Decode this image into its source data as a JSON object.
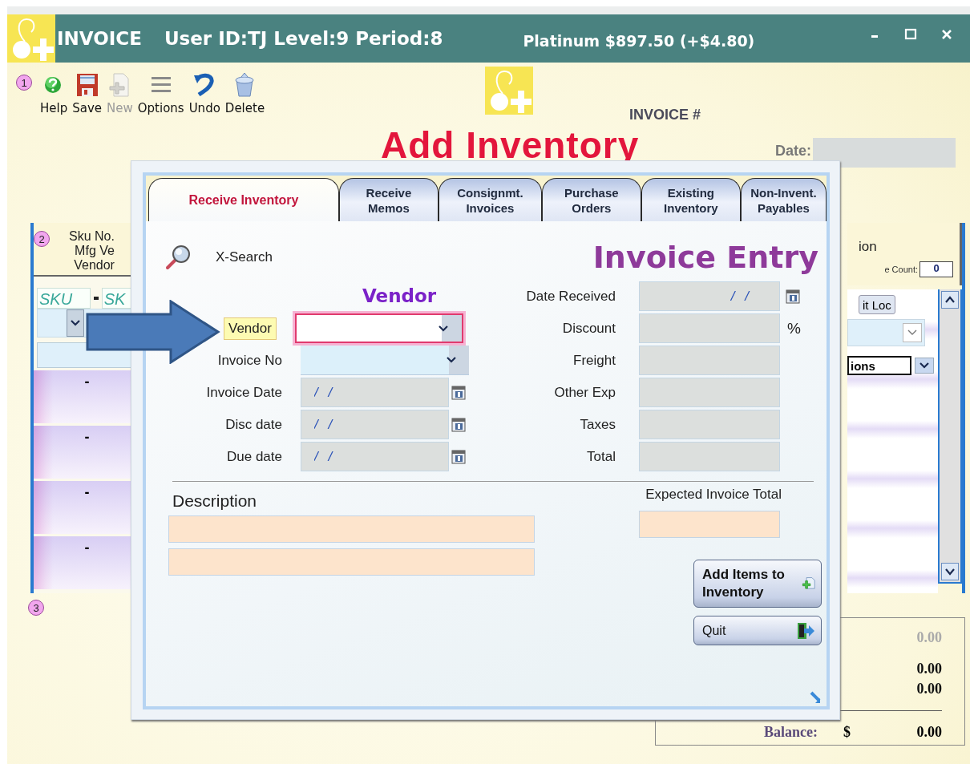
{
  "window": {
    "title": "INVOICE",
    "user_info": "User ID:TJ  Level:9 Period:8",
    "metal_price": "Platinum $897.50 (+$4.80)"
  },
  "toolbar": {
    "step": "1",
    "buttons": [
      {
        "label": "Help",
        "kind": "help",
        "disabled": false
      },
      {
        "label": "Save",
        "kind": "save",
        "disabled": false
      },
      {
        "label": "New",
        "kind": "new",
        "disabled": true
      },
      {
        "label": "Options",
        "kind": "options",
        "disabled": false
      },
      {
        "label": "Undo",
        "kind": "undo",
        "disabled": false
      },
      {
        "label": "Delete",
        "kind": "delete",
        "disabled": false
      }
    ]
  },
  "header": {
    "invoice_label": "INVOICE #",
    "title": "Add Inventory",
    "date_label": "Date:"
  },
  "items_panel": {
    "step": "2",
    "heading_lines": [
      "Sku No.",
      "Mfg  Ve",
      "Vendor"
    ],
    "sku_fields": [
      "SKU",
      "SK"
    ],
    "rows": [
      "-",
      "-",
      "-",
      "-"
    ]
  },
  "right_panel": {
    "heading": "ion",
    "count_label": "e Count:",
    "count": "0",
    "loc_button": "it Loc",
    "options_label": "ions"
  },
  "notes": {
    "step": "3"
  },
  "totals": {
    "rows": [
      {
        "value": "0.00",
        "muted": true
      },
      {
        "value": "0.00",
        "muted": false
      },
      {
        "value": "0.00",
        "muted": false
      }
    ],
    "balance": {
      "label": "Balance:",
      "currency": "$",
      "value": "0.00"
    }
  },
  "dialog": {
    "tabs": [
      {
        "lines": [
          "Receive Inventory"
        ],
        "selected": true
      },
      {
        "lines": [
          "Receive",
          "Memos"
        ],
        "selected": false
      },
      {
        "lines": [
          "Consignmt.",
          "Invoices"
        ],
        "selected": false
      },
      {
        "lines": [
          "Purchase",
          "Orders"
        ],
        "selected": false
      },
      {
        "lines": [
          "Existing",
          "Inventory"
        ],
        "selected": false
      },
      {
        "lines": [
          "Non-Invent.",
          "Payables"
        ],
        "selected": false
      }
    ],
    "search_label": "X-Search",
    "title": "Invoice Entry",
    "vendor_heading": "Vendor",
    "left_fields": [
      {
        "label": "Vendor",
        "kind": "combo",
        "focused": true
      },
      {
        "label": "Invoice No",
        "kind": "combo",
        "focused": false
      },
      {
        "label": "Invoice Date",
        "kind": "date",
        "value": "/ /"
      },
      {
        "label": "Disc date",
        "kind": "date",
        "value": "/ /"
      },
      {
        "label": "Due date",
        "kind": "date",
        "value": "/ /"
      }
    ],
    "right_fields": [
      {
        "label": "Date Received",
        "kind": "date",
        "value": "/ /"
      },
      {
        "label": "Discount",
        "kind": "percent",
        "suffix": "%"
      },
      {
        "label": "Freight",
        "kind": "amount"
      },
      {
        "label": "Other Exp",
        "kind": "amount"
      },
      {
        "label": "Taxes",
        "kind": "amount"
      },
      {
        "label": "Total",
        "kind": "amount"
      }
    ],
    "description_label": "Description",
    "expected_total_label": "Expected Invoice Total",
    "buttons": [
      {
        "label": "Add Items to Inventory",
        "kind": "add"
      },
      {
        "label": "Quit",
        "kind": "quit"
      }
    ]
  }
}
